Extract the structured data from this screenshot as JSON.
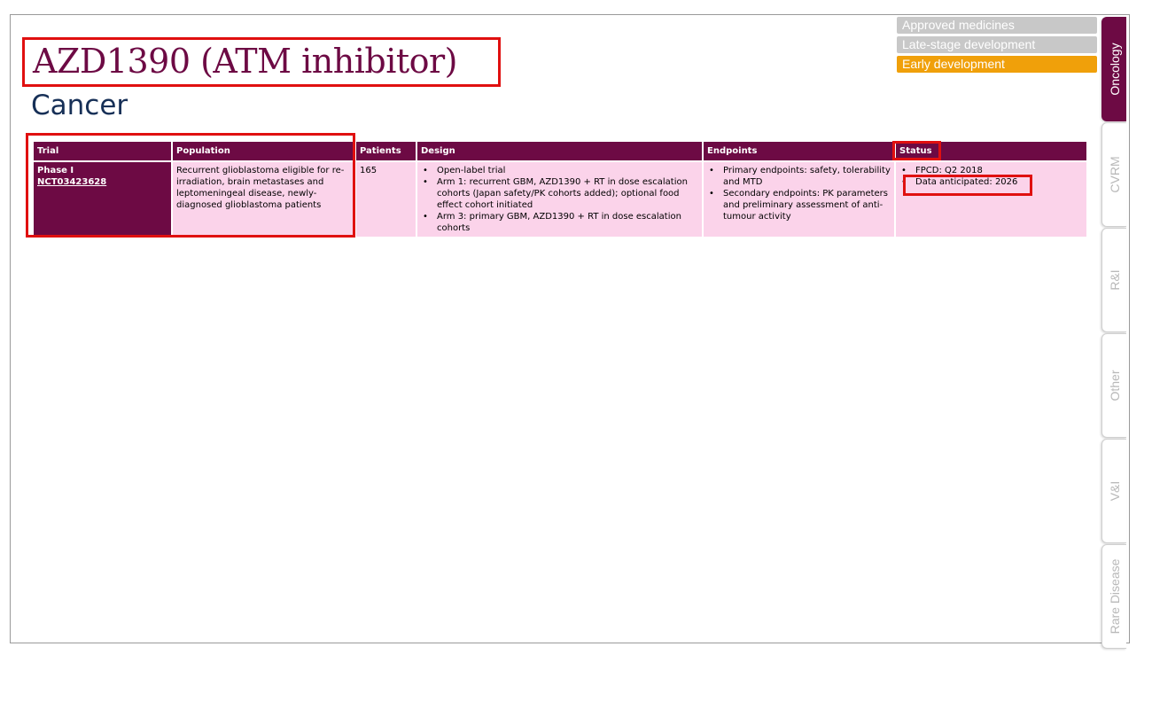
{
  "title": "AZD1390 (ATM inhibitor)",
  "subtitle": "Cancer",
  "legend": [
    {
      "label": "Approved medicines",
      "active": false
    },
    {
      "label": "Late-stage development",
      "active": false
    },
    {
      "label": "Early development",
      "active": true
    }
  ],
  "tabs": [
    {
      "label": "Oncology",
      "active": true
    },
    {
      "label": "CVRM",
      "active": false
    },
    {
      "label": "R&I",
      "active": false
    },
    {
      "label": "Other",
      "active": false
    },
    {
      "label": "V&I",
      "active": false
    },
    {
      "label": "Rare Disease",
      "active": false
    }
  ],
  "table": {
    "headers": {
      "trial": "Trial",
      "population": "Population",
      "patients": "Patients",
      "design": "Design",
      "endpoints": "Endpoints",
      "status": "Status"
    },
    "row": {
      "phase": "Phase I",
      "trial_id": "NCT03423628",
      "population": "Recurrent glioblastoma eligible for re-irradiation, brain metastases and leptomeningeal disease, newly-diagnosed glioblastoma patients",
      "patients": "165",
      "design": [
        "Open-label trial",
        "Arm 1: recurrent GBM, AZD1390 + RT in dose escalation cohorts (Japan safety/PK cohorts added); optional food effect cohort initiated",
        "Arm 3: primary GBM, AZD1390 + RT in dose escalation cohorts"
      ],
      "endpoints": [
        "Primary endpoints: safety, tolerability and MTD",
        "Secondary endpoints: PK parameters and preliminary assessment of anti-tumour activity"
      ],
      "status": [
        "FPCD: Q2 2018",
        "Data anticipated: 2026"
      ]
    }
  },
  "colors": {
    "brand": "#6d0a44",
    "title_blue": "#173057",
    "row_fill": "#fbd3ea",
    "early_dev": "#f0a00a",
    "inactive": "#c8c8c8",
    "highlight": "#e01010"
  }
}
